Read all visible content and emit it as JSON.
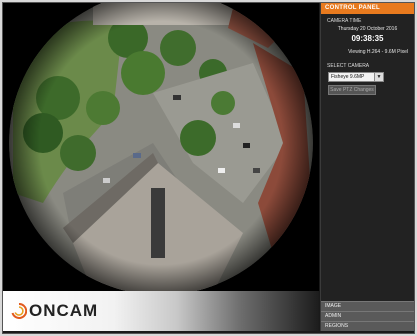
{
  "panel": {
    "header": "CONTROL PANEL",
    "camera_time_label": "CAMERA TIME",
    "date": "Thursday 20 October 2016",
    "time": "09:38:35",
    "viewing": "Viewing H.264 - 9.6M Pixel",
    "select_camera_label": "SELECT CAMERA",
    "camera_selected": "Fisheye 9.6MP",
    "save_button": "Save PTZ Changes",
    "menu": [
      "IMAGE",
      "ADMIN",
      "REGIONS"
    ]
  },
  "branding": {
    "logo_text": "ONCAM"
  },
  "colors": {
    "accent": "#e87a1e",
    "panel_bg": "#222222"
  },
  "video": {
    "description_icon": "fisheye-camera-view"
  }
}
